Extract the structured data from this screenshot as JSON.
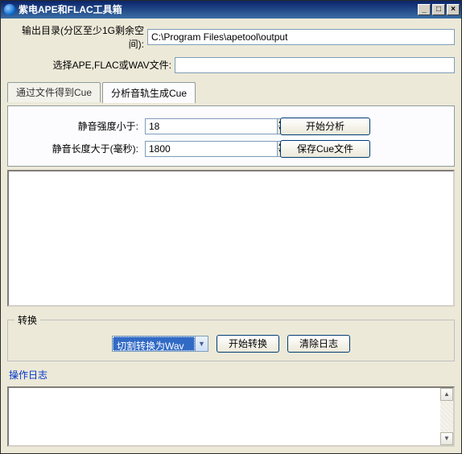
{
  "title": "紫电APE和FLAC工具箱",
  "output_dir_label": "输出目录(分区至少1G剩余空间):",
  "output_dir_value": "C:\\Program Files\\apetool\\output",
  "select_file_label": "选择APE,FLAC或WAV文件:",
  "select_file_value": "",
  "tabs": {
    "t0": "通过文件得到Cue",
    "t1": "分析音轨生成Cue"
  },
  "panel": {
    "silence_lt_label": "静音强度小于:",
    "silence_lt_value": "18",
    "silence_len_label": "静音长度大于(毫秒):",
    "silence_len_value": "1800",
    "analyze_btn": "开始分析",
    "save_cue_btn": "保存Cue文件"
  },
  "convert": {
    "legend": "转换",
    "mode_selected": "切割转换为Wav",
    "start_btn": "开始转换",
    "clear_btn": "清除日志"
  },
  "log_label": "操作日志",
  "winbtns": {
    "min": "_",
    "max": "□",
    "close": "×"
  },
  "arrows": {
    "up": "▲",
    "down": "▼"
  }
}
